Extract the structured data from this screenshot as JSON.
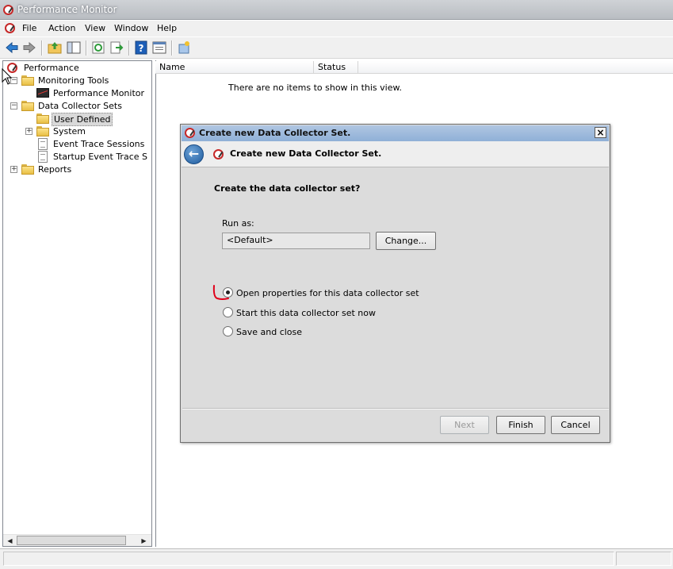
{
  "window": {
    "title": "Performance Monitor"
  },
  "menu": [
    "File",
    "Action",
    "View",
    "Window",
    "Help"
  ],
  "toolbar": {
    "icons": [
      "back-arrow-icon",
      "forward-arrow-icon",
      "up-folder-icon",
      "show-hide-tree-icon",
      "refresh-icon",
      "export-list-icon",
      "help-icon",
      "properties-icon",
      "new-icon"
    ]
  },
  "tree": {
    "root": "Performance",
    "monitoring_tools": "Monitoring Tools",
    "performance_monitor": "Performance Monitor",
    "data_collector_sets": "Data Collector Sets",
    "user_defined": "User Defined",
    "system": "System",
    "event_trace_sessions": "Event Trace Sessions",
    "startup_event_trace_sessions": "Startup Event Trace Sess",
    "reports": "Reports"
  },
  "list": {
    "columns": [
      "Name",
      "Status"
    ],
    "empty_message": "There are no items to show in this view."
  },
  "dialog": {
    "title": "Create new Data Collector Set.",
    "header": "Create new Data Collector Set.",
    "question": "Create the data collector set?",
    "run_as_label": "Run as:",
    "run_as_value": "<Default>",
    "change_button": "Change...",
    "options": [
      {
        "label": "Open properties for this data collector set",
        "selected": true
      },
      {
        "label": "Start this data collector set now",
        "selected": false
      },
      {
        "label": "Save and close",
        "selected": false
      }
    ],
    "next_button": "Next",
    "finish_button": "Finish",
    "cancel_button": "Cancel"
  },
  "colors": {
    "dialog_title": "#9bb8dc",
    "annotation": "#e0001a"
  }
}
